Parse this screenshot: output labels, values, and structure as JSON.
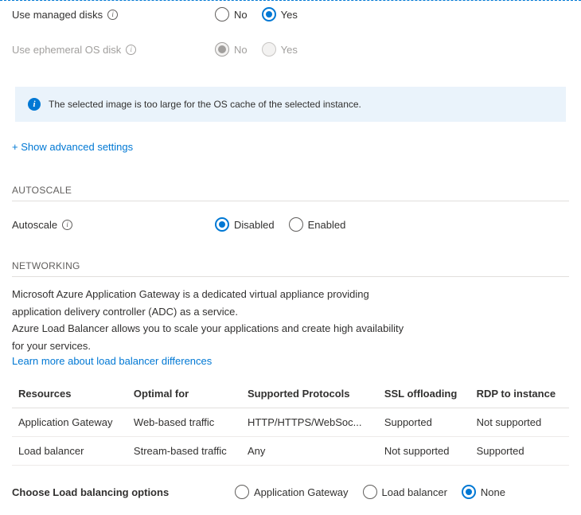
{
  "fields": {
    "managed_disks": {
      "label": "Use managed disks",
      "no": "No",
      "yes": "Yes"
    },
    "ephemeral_os": {
      "label": "Use ephemeral OS disk",
      "no": "No",
      "yes": "Yes"
    }
  },
  "info": {
    "message": "The selected image is too large for the OS cache of the selected instance."
  },
  "links": {
    "show_advanced": "+ Show advanced settings",
    "lb_learn_more": "Learn more about load balancer differences"
  },
  "sections": {
    "autoscale": "AUTOSCALE",
    "networking": "NETWORKING"
  },
  "autoscale": {
    "label": "Autoscale",
    "disabled": "Disabled",
    "enabled": "Enabled"
  },
  "networking": {
    "desc_line1": "Microsoft Azure Application Gateway is a dedicated virtual appliance providing",
    "desc_line2": "application delivery controller (ADC) as a service.",
    "desc_line3": "Azure Load Balancer allows you to scale your applications and create high availability",
    "desc_line4": "for your services."
  },
  "table": {
    "headers": {
      "resources": "Resources",
      "optimal": "Optimal for",
      "protocols": "Supported Protocols",
      "ssl": "SSL offloading",
      "rdp": "RDP to instance"
    },
    "rows": [
      {
        "resources": "Application Gateway",
        "optimal": "Web-based traffic",
        "protocols": "HTTP/HTTPS/WebSoc...",
        "ssl": "Supported",
        "rdp": "Not supported"
      },
      {
        "resources": "Load balancer",
        "optimal": "Stream-based traffic",
        "protocols": "Any",
        "ssl": "Not supported",
        "rdp": "Supported"
      }
    ]
  },
  "lb_choose": {
    "label": "Choose Load balancing options",
    "opt_gateway": "Application Gateway",
    "opt_lb": "Load balancer",
    "opt_none": "None"
  }
}
